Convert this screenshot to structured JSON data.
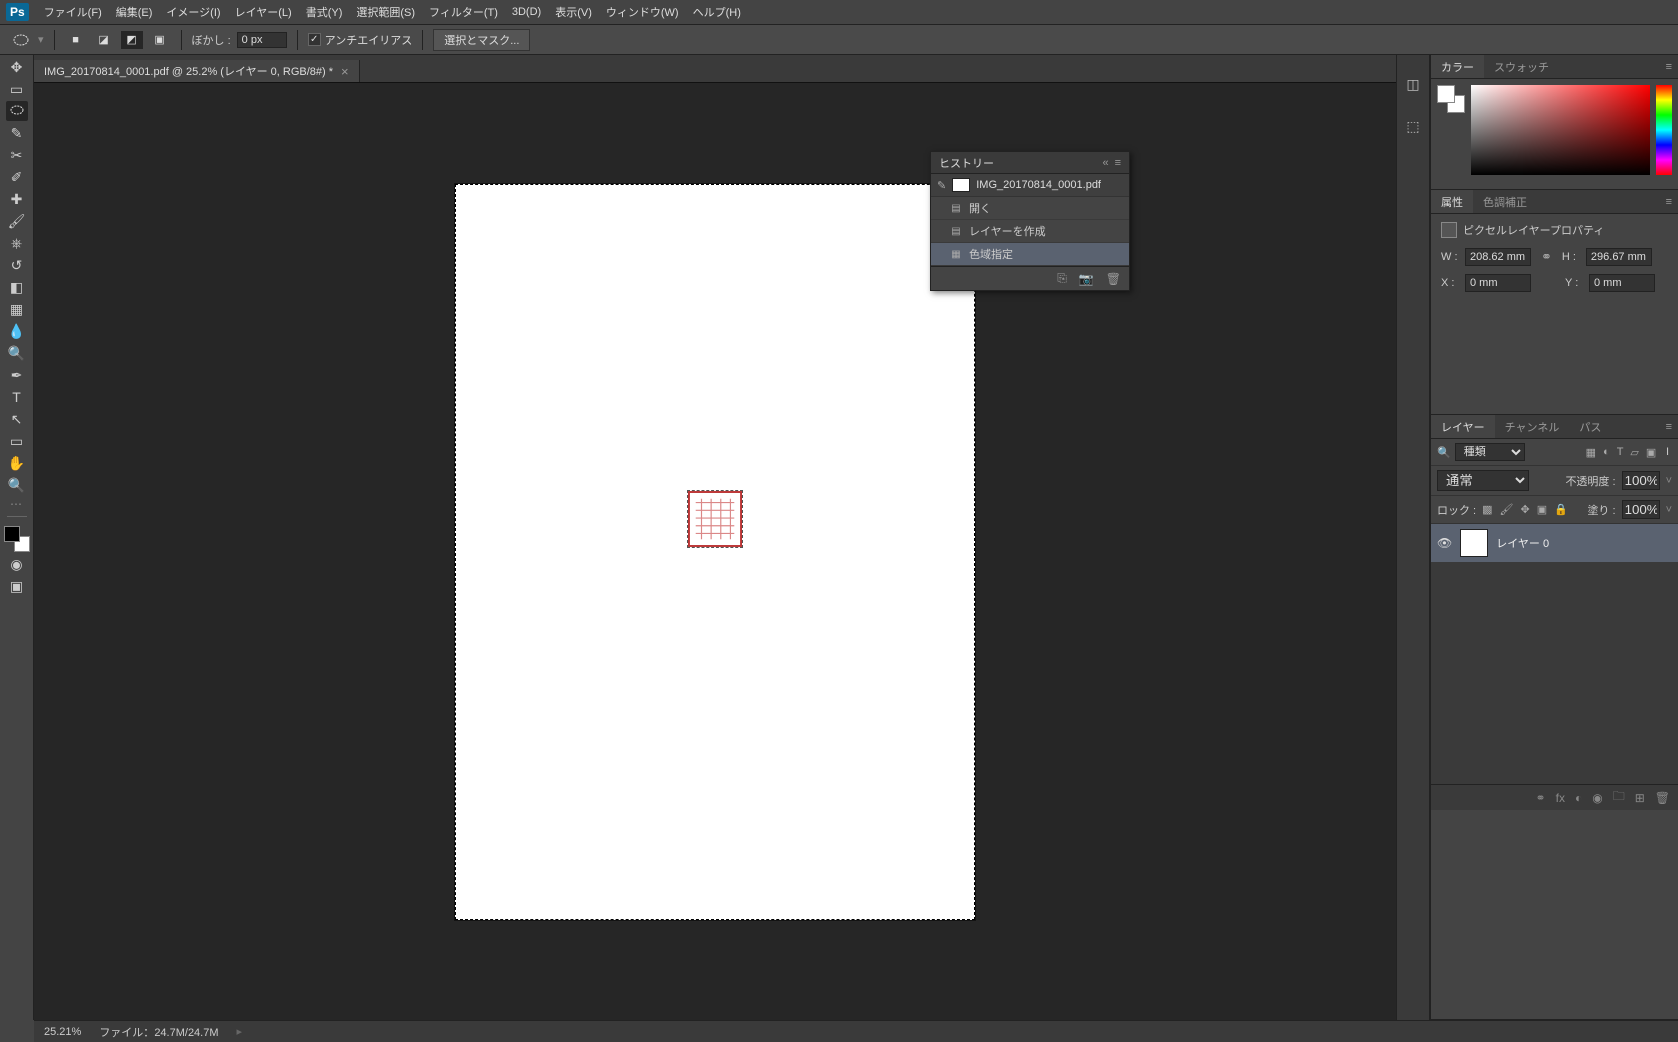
{
  "menubar": {
    "items": [
      "ファイル(F)",
      "編集(E)",
      "イメージ(I)",
      "レイヤー(L)",
      "書式(Y)",
      "選択範囲(S)",
      "フィルター(T)",
      "3D(D)",
      "表示(V)",
      "ウィンドウ(W)",
      "ヘルプ(H)"
    ]
  },
  "options": {
    "feather_label": "ぼかし :",
    "feather_value": "0 px",
    "antialias": "アンチエイリアス",
    "refine": "選択とマスク..."
  },
  "document": {
    "tab_title": "IMG_20170814_0001.pdf @ 25.2% (レイヤー 0, RGB/8#) *"
  },
  "history": {
    "title": "ヒストリー",
    "docname": "IMG_20170814_0001.pdf",
    "items": [
      "開く",
      "レイヤーを作成",
      "色域指定"
    ]
  },
  "color_panel": {
    "tabs": [
      "カラー",
      "スウォッチ"
    ]
  },
  "properties_panel": {
    "tabs": [
      "属性",
      "色調補正"
    ],
    "title": "ピクセルレイヤープロパティ",
    "w_label": "W :",
    "w_value": "208.62 mm",
    "h_label": "H :",
    "h_value": "296.67 mm",
    "x_label": "X :",
    "x_value": "0 mm",
    "y_label": "Y :",
    "y_value": "0 mm"
  },
  "layers_panel": {
    "tabs": [
      "レイヤー",
      "チャンネル",
      "パス"
    ],
    "filter_label": "種類",
    "blend_mode": "通常",
    "opacity_label": "不透明度 :",
    "opacity_value": "100%",
    "lock_label": "ロック :",
    "fill_label": "塗り :",
    "fill_value": "100%",
    "layer0": "レイヤー 0"
  },
  "status": {
    "zoom": "25.21%",
    "doc_label": "ファイル：",
    "doc_size": "24.7M/24.7M"
  }
}
